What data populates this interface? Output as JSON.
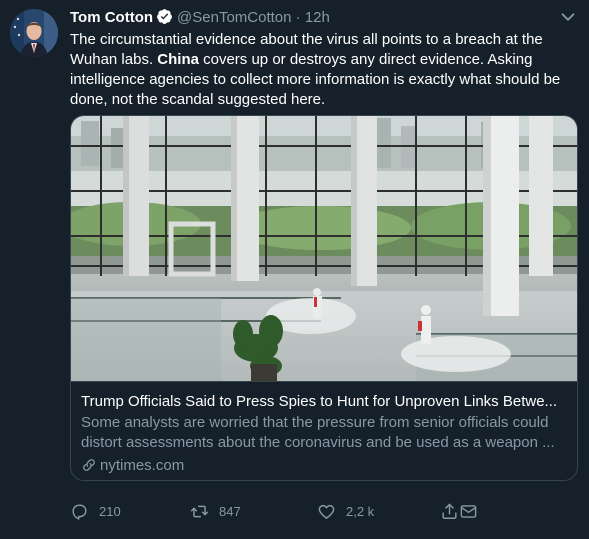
{
  "tweet": {
    "author_name": "Tom Cotton",
    "handle": "@SenTomCotton",
    "separator": "·",
    "time": "12h",
    "text_part1": "The circumstantial evidence about the virus all points to a breach at the Wuhan labs. ",
    "text_bold": "China",
    "text_part2": " covers up or destroys any direct evidence. Asking intelligence agencies to collect more information is exactly what should be done, not the scandal suggested here."
  },
  "card": {
    "title": "Trump Officials Said to Press Spies to Hunt for Unproven Links Betwe...",
    "description_line1": "Some analysts are worried that the pressure from senior officials could",
    "description_line2": "distort assessments about the coronavirus and be used as a weapon ...",
    "domain": "nytimes.com"
  },
  "actions": {
    "replies": "210",
    "retweets": "847",
    "likes": "2,2 k"
  },
  "icons": {
    "verified": "verified-badge-icon",
    "more": "chevron-down-icon",
    "reply": "reply-icon",
    "retweet": "retweet-icon",
    "like": "heart-icon",
    "share": "share-icon",
    "link": "link-icon"
  },
  "colors": {
    "background": "#15202b",
    "secondary_text": "#8899a6",
    "accent": "#1da1f2",
    "border": "#38444d"
  }
}
